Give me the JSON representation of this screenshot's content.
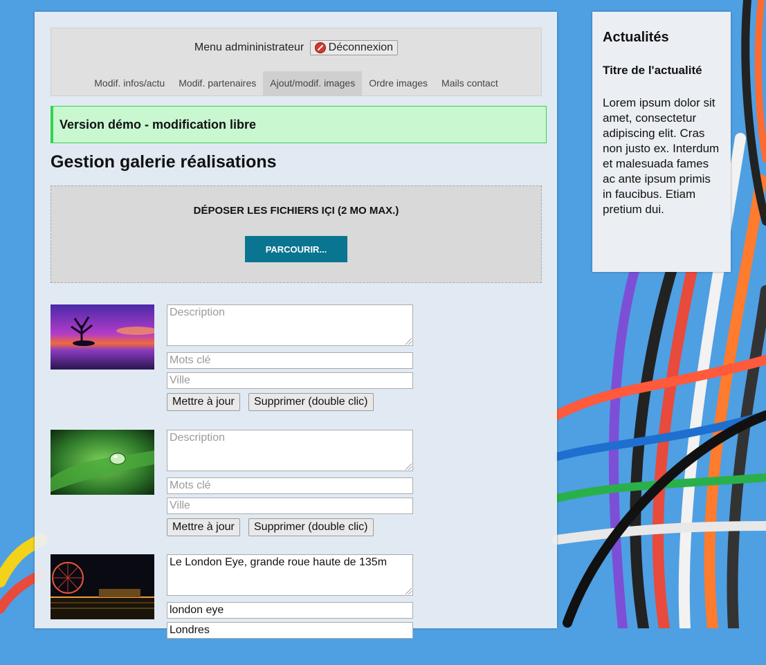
{
  "admin": {
    "menu_title": "Menu admininistrateur",
    "logout_label": "Déconnexion",
    "tabs": [
      {
        "label": "Modif. infos/actu",
        "active": false
      },
      {
        "label": "Modif. partenaires",
        "active": false
      },
      {
        "label": "Ajout/modif. images",
        "active": true
      },
      {
        "label": "Ordre images",
        "active": false
      },
      {
        "label": "Mails contact",
        "active": false
      }
    ]
  },
  "banner": "Version démo - modification libre",
  "page_title": "Gestion galerie réalisations",
  "dropzone": {
    "label": "DÉPOSER LES FICHIERS IÇI (2 MO MAX.)",
    "button": "PARCOURIR..."
  },
  "form": {
    "description_placeholder": "Description",
    "keywords_placeholder": "Mots clé",
    "city_placeholder": "Ville",
    "update_label": "Mettre à jour",
    "delete_label": "Supprimer (double clic)"
  },
  "images": [
    {
      "thumbnail": "purple-sunset-lake",
      "description": "",
      "keywords": "",
      "city": ""
    },
    {
      "thumbnail": "green-leaf-waterdrop",
      "description": "",
      "keywords": "",
      "city": ""
    },
    {
      "thumbnail": "london-eye-night",
      "description": "Le London Eye, grande roue haute de 135m",
      "keywords": "london eye",
      "city": "Londres"
    }
  ],
  "news": {
    "heading": "Actualités",
    "item_title": "Titre de l'actualité",
    "item_body": "Lorem ipsum dolor sit amet, consectetur adipiscing elit. Cras non justo ex. Interdum et malesuada fames ac ante ipsum primis in faucibus. Etiam pretium dui."
  },
  "colors": {
    "background": "#4f9fe3",
    "banner_bg": "#c8f7d0",
    "banner_border": "#36d24c",
    "browse_button": "#0a7590"
  }
}
